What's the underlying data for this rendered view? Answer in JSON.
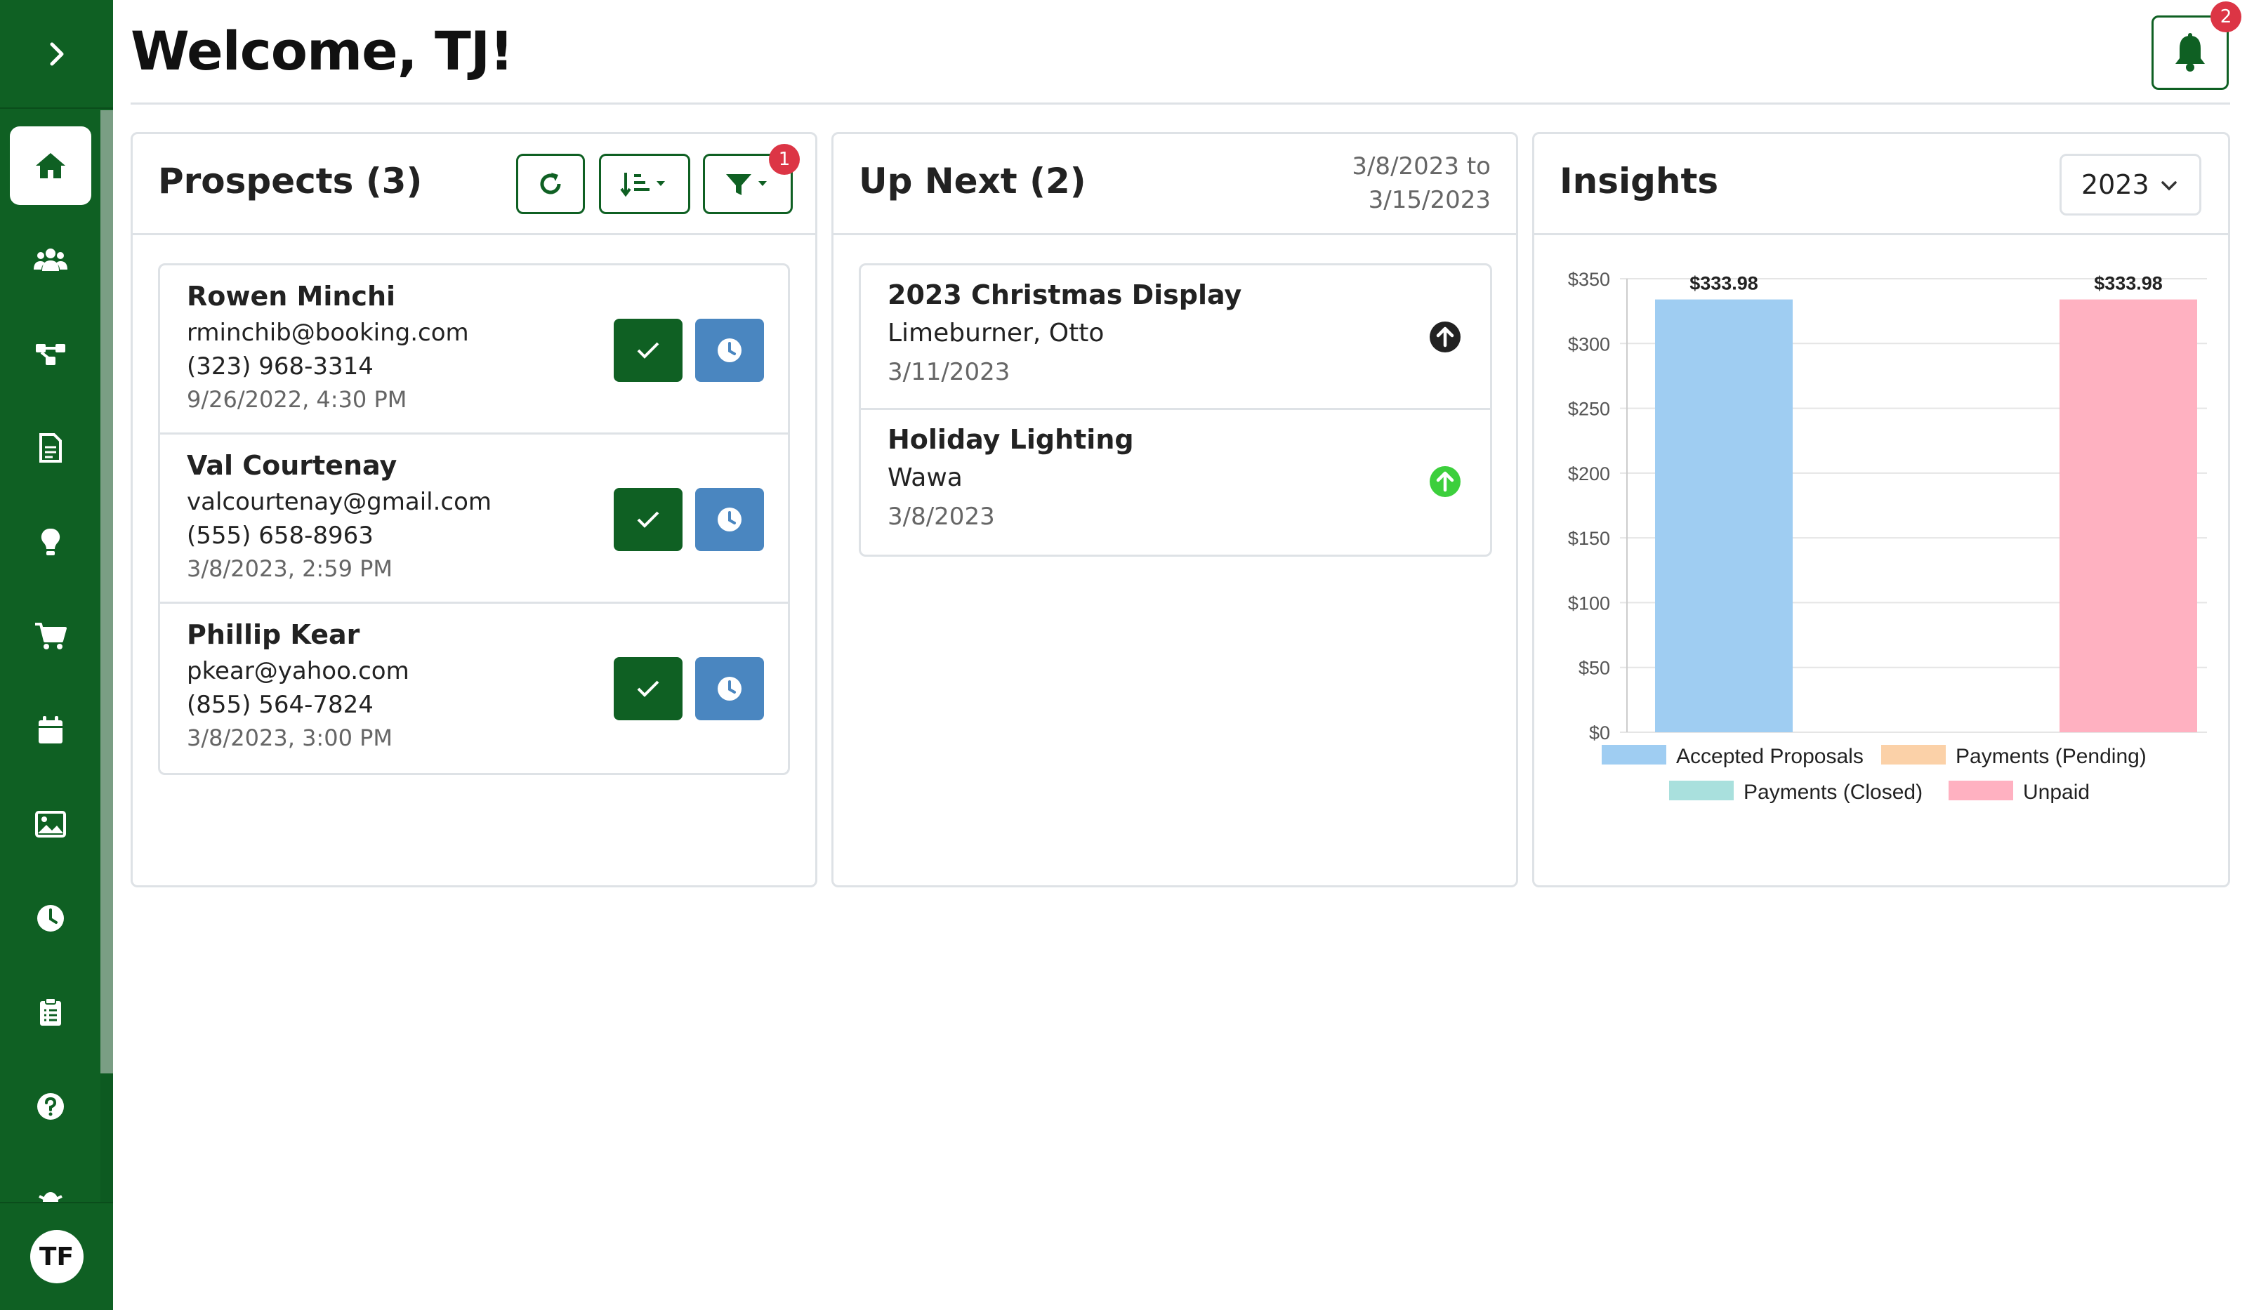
{
  "header": {
    "title": "Welcome, TJ!",
    "notification_count": "2"
  },
  "sidebar": {
    "items": [
      {
        "icon": "home-icon",
        "active": true
      },
      {
        "icon": "users-icon"
      },
      {
        "icon": "workflow-icon"
      },
      {
        "icon": "document-icon"
      },
      {
        "icon": "lightbulb-icon"
      },
      {
        "icon": "cart-icon"
      },
      {
        "icon": "calendar-icon"
      },
      {
        "icon": "image-icon"
      },
      {
        "icon": "clock-icon"
      },
      {
        "icon": "clipboard-icon"
      },
      {
        "icon": "help-icon"
      },
      {
        "icon": "bug-icon"
      }
    ],
    "avatar_initials": "TF"
  },
  "prospects": {
    "title": "Prospects (3)",
    "filter_count": "1",
    "items": [
      {
        "name": "Rowen Minchi",
        "email": "rminchib@booking.com",
        "phone": "(323) 968-3314",
        "date": "9/26/2022, 4:30 PM"
      },
      {
        "name": "Val Courtenay",
        "email": "valcourtenay@gmail.com",
        "phone": "(555) 658-8963",
        "date": "3/8/2023, 2:59 PM"
      },
      {
        "name": "Phillip Kear",
        "email": "pkear@yahoo.com",
        "phone": "(855) 564-7824",
        "date": "3/8/2023, 3:00 PM"
      }
    ]
  },
  "upnext": {
    "title": "Up Next (2)",
    "range_start": "3/8/2023 to",
    "range_end": "3/15/2023",
    "items": [
      {
        "title": "2023 Christmas Display",
        "client": "Limeburner, Otto",
        "date": "3/11/2023",
        "status_color": "#222222"
      },
      {
        "title": "Holiday Lighting",
        "client": "Wawa",
        "date": "3/8/2023",
        "status_color": "#3ccf3c"
      }
    ]
  },
  "insights": {
    "title": "Insights",
    "year": "2023"
  },
  "chart_data": {
    "type": "bar",
    "series": [
      {
        "name": "Accepted Proposals",
        "value": 333.98,
        "label": "$333.98",
        "color": "#9fcdf2"
      },
      {
        "name": "Payments (Pending)",
        "value": 0,
        "color": "#fbd1a8"
      },
      {
        "name": "Payments (Closed)",
        "value": 0,
        "color": "#a9e0dd"
      },
      {
        "name": "Unpaid",
        "value": 333.98,
        "label": "$333.98",
        "color": "#ffb1c1"
      }
    ],
    "ylim": [
      0,
      350
    ],
    "yticks": [
      0,
      50,
      100,
      150,
      200,
      250,
      300,
      350
    ],
    "ytick_labels": [
      "$0",
      "$50",
      "$100",
      "$150",
      "$200",
      "$250",
      "$300",
      "$350"
    ],
    "grid": true,
    "legend": "bottom"
  },
  "colors": {
    "brand": "#0f6023",
    "accent_blue": "#4a86c0",
    "badge": "#dc3545"
  }
}
